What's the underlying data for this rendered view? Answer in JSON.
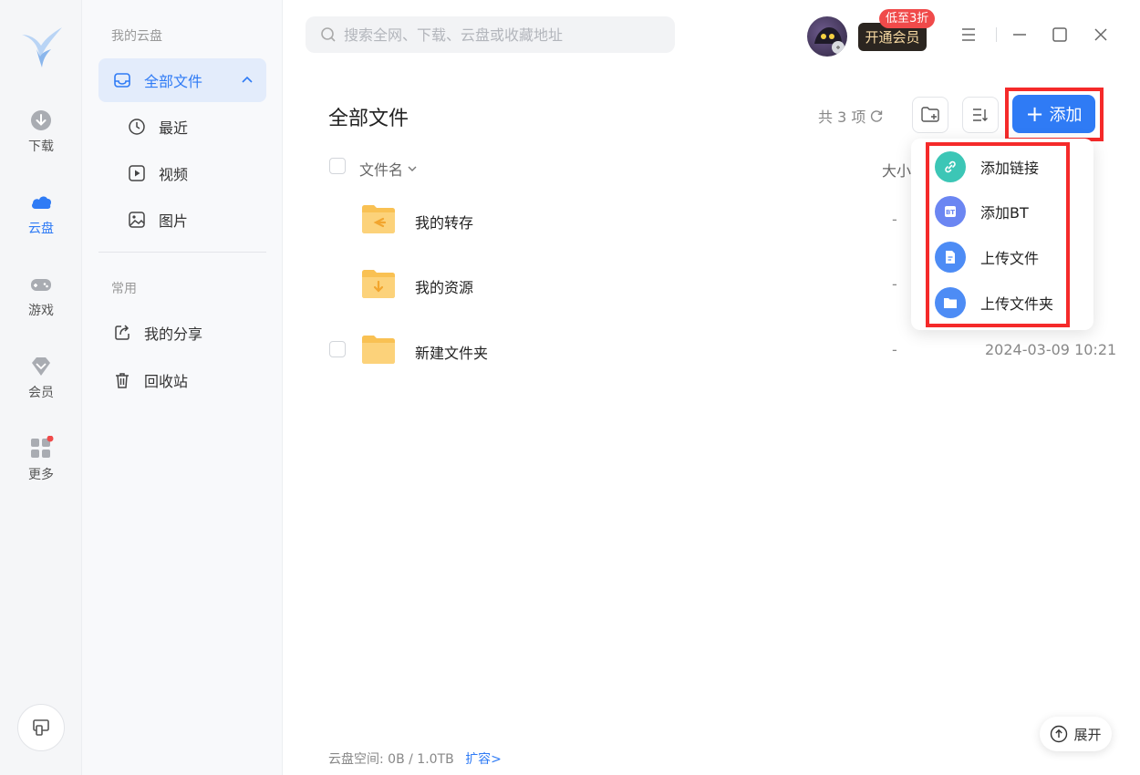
{
  "rail": {
    "items": [
      {
        "label": "下载",
        "icon": "download-icon"
      },
      {
        "label": "云盘",
        "icon": "cloud-icon"
      },
      {
        "label": "游戏",
        "icon": "gamepad-icon"
      },
      {
        "label": "会员",
        "icon": "diamond-icon"
      },
      {
        "label": "更多",
        "icon": "apps-icon"
      }
    ],
    "accent": "#2f7bf5"
  },
  "sidebar": {
    "group_cloud": "我的云盘",
    "all_files": "全部文件",
    "recent": "最近",
    "video": "视频",
    "pictures": "图片",
    "group_common": "常用",
    "my_share": "我的分享",
    "recycle_bin": "回收站"
  },
  "topbar": {
    "search_placeholder": "搜索全网、下载、云盘或收藏地址",
    "vip_button": "开通会员",
    "vip_badge": "低至3折"
  },
  "main": {
    "title": "全部文件",
    "count": "共 3 项",
    "add_button": "添加",
    "col_name": "文件名",
    "col_size": "大小",
    "rows": [
      {
        "name": "我的转存",
        "size": "-",
        "date": "",
        "type": "folder-transfer"
      },
      {
        "name": "我的资源",
        "size": "-",
        "date": "",
        "type": "folder-download"
      },
      {
        "name": "新建文件夹",
        "size": "-",
        "date": "2024-03-09 10:21",
        "type": "folder"
      }
    ]
  },
  "add_menu": {
    "items": [
      {
        "label": "添加链接",
        "icon": "link-icon",
        "color": "#3cc6b6"
      },
      {
        "label": "添加BT",
        "icon": "bt-icon",
        "color": "#6b86f2"
      },
      {
        "label": "上传文件",
        "icon": "file-icon",
        "color": "#4d8cf5"
      },
      {
        "label": "上传文件夹",
        "icon": "folder-icon",
        "color": "#4d8cf5"
      }
    ]
  },
  "footer": {
    "storage_label": "云盘空间:",
    "storage_value": "0B / 1.0TB",
    "expand_link": "扩容>",
    "expand_button": "展开"
  }
}
